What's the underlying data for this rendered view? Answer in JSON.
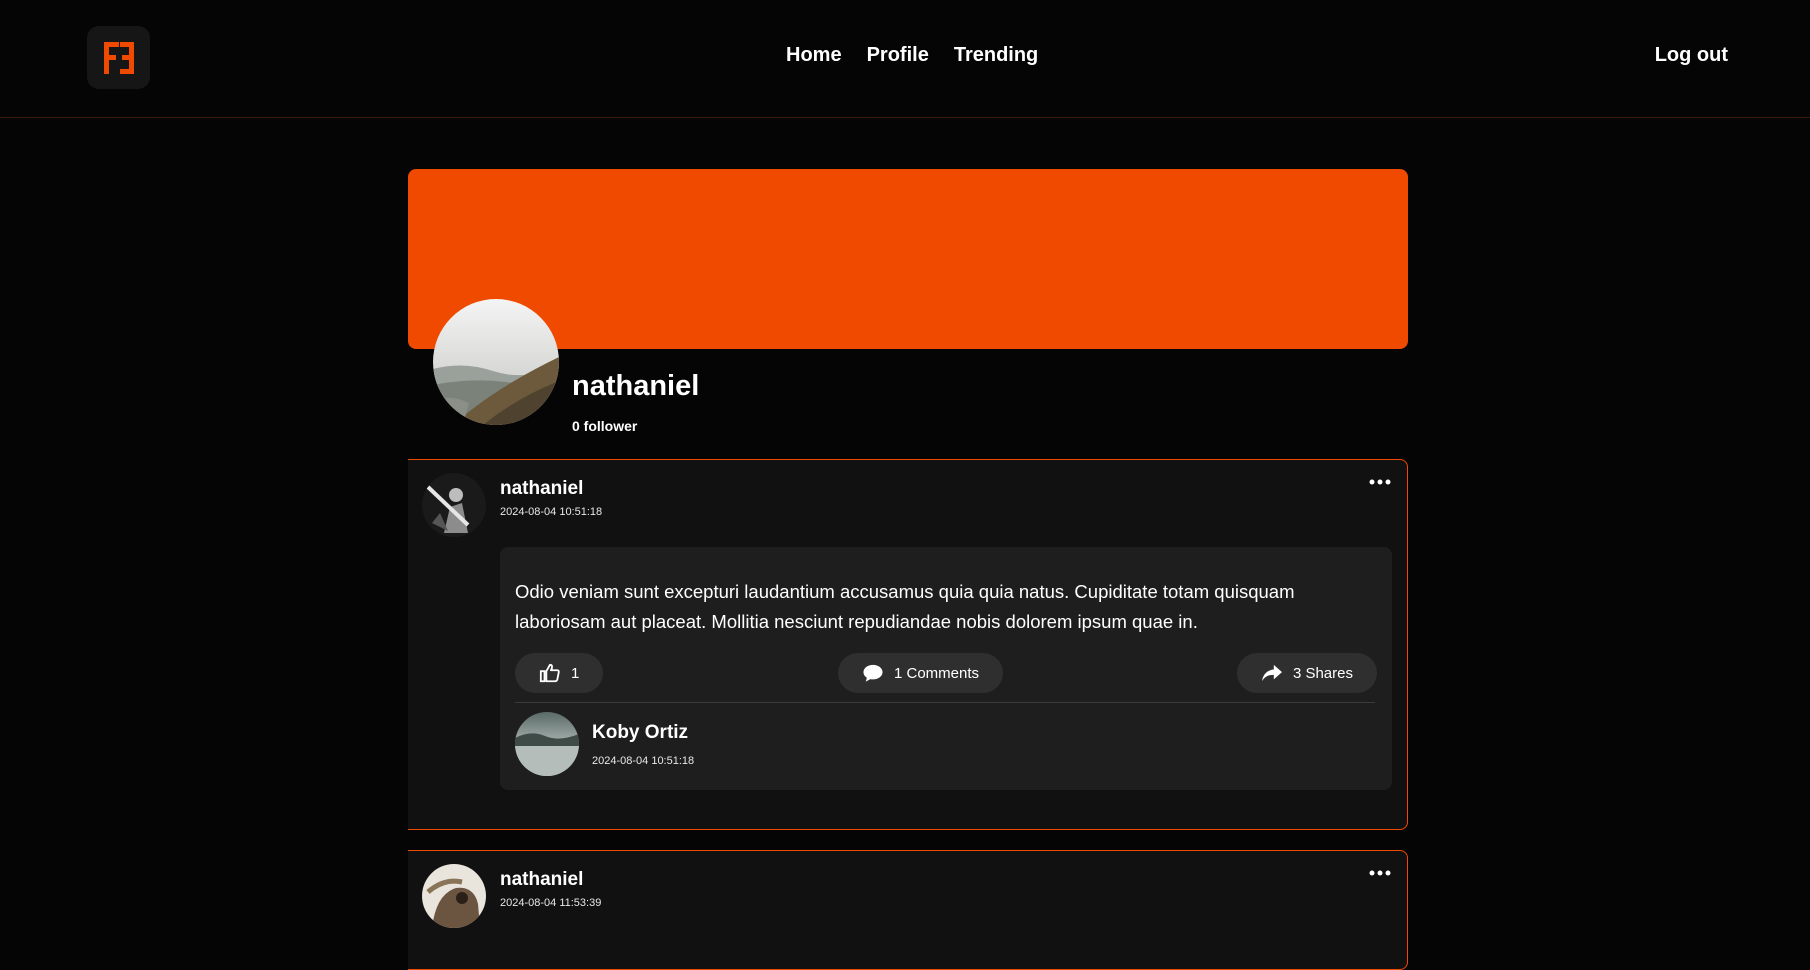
{
  "app": {
    "logo_icon": "ff-logo-icon",
    "accent_color": "#f04a00"
  },
  "nav": {
    "links": [
      "Home",
      "Profile",
      "Trending"
    ],
    "logout": "Log out"
  },
  "profile": {
    "name": "nathaniel",
    "followers": "0 follower",
    "cover_color": "#f04a00"
  },
  "posts": [
    {
      "author": "nathaniel",
      "date": "2024-08-04 10:51:18",
      "text": "Odio veniam sunt excepturi laudantium accusamus quia quia natus. Cupiditate totam quisquam laboriosam aut placeat. Mollitia nesciunt repudiandae nobis dolorem ipsum quae in.",
      "likes": "1",
      "comments_label": "1 Comments",
      "shares_label": "3 Shares",
      "comment": {
        "author": "Koby Ortiz",
        "date": "2024-08-04 10:51:18"
      }
    },
    {
      "author": "nathaniel",
      "date": "2024-08-04 11:53:39"
    }
  ]
}
